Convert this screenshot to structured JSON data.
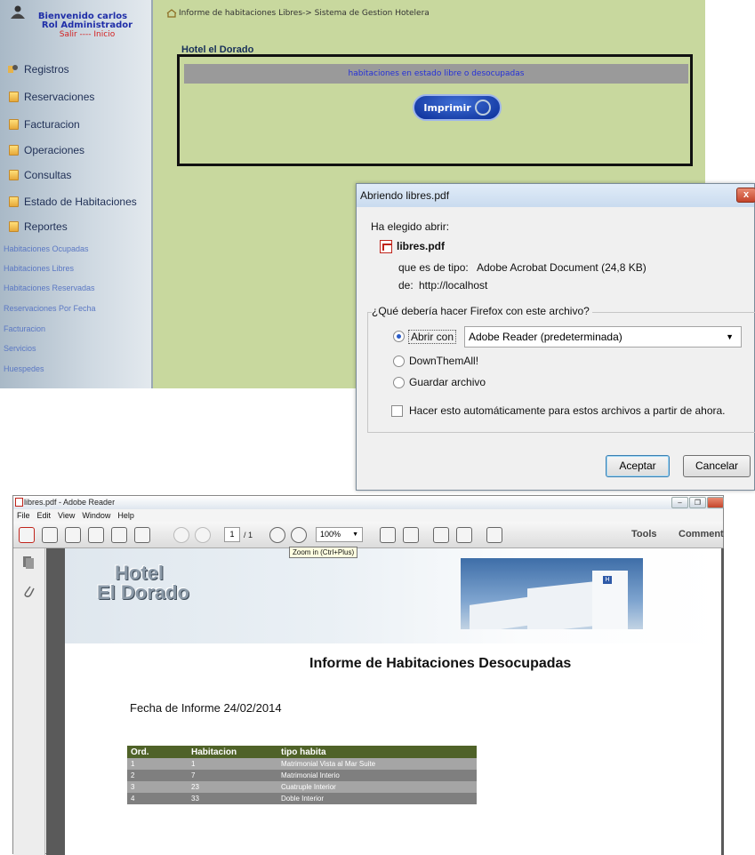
{
  "webapp": {
    "user": {
      "greeting": "Bienvenido carlos",
      "role": "Rol Administrador",
      "links": "Salir ---- Inicio"
    },
    "nav": [
      "Registros",
      "Reservaciones",
      "Facturacion",
      "Operaciones",
      "Consultas",
      "Estado de Habitaciones",
      "Reportes"
    ],
    "subnav": [
      "Habitaciones Ocupadas",
      "Habitaciones Libres",
      "Habitaciones Reservadas",
      "Reservaciones Por Fecha",
      "Facturacion",
      "Servicios",
      "Huespedes"
    ],
    "breadcrumb": "Informe de habitaciones Libres-> Sistema de Gestion Hotelera",
    "hotel_name": "Hotel el Dorado",
    "panel_heading": "habitaciones en estado libre o desocupadas",
    "print_button": "Imprimir"
  },
  "dialog": {
    "title": "Abriendo libres.pdf",
    "close": "x",
    "chosen": "Ha elegido abrir:",
    "file_name": "libres.pdf",
    "type_label": "que es de tipo:",
    "type_value": "Adobe Acrobat Document (24,8 KB)",
    "from_label": "de:",
    "from_value": "http://localhost",
    "question": "¿Qué debería hacer Firefox con este archivo?",
    "open_with": "Abrir con",
    "app": "Adobe Reader  (predeterminada)",
    "downthemall": "DownThemAll!",
    "save": "Guardar archivo",
    "auto": "Hacer esto automáticamente para estos archivos a partir de ahora.",
    "ok": "Aceptar",
    "cancel": "Cancelar",
    "open_with_selected": true
  },
  "reader": {
    "title": "libres.pdf - Adobe Reader",
    "menu": [
      "File",
      "Edit",
      "View",
      "Window",
      "Help"
    ],
    "page_current": "1",
    "page_total": "/ 1",
    "zoom": "100%",
    "tooltip": "Zoom in (Ctrl+Plus)",
    "tools": "Tools",
    "comment": "Comment"
  },
  "pdf": {
    "logo_line1": "Hotel",
    "logo_line2": "El Dorado",
    "heading": "Informe de Habitaciones Desocupadas",
    "date_line": "Fecha de Informe 24/02/2014",
    "columns": [
      "Ord.",
      "Habitacion",
      "tipo habita"
    ],
    "rows": [
      [
        "1",
        "1",
        "Matrimonial Vista al Mar Suite"
      ],
      [
        "2",
        "7",
        "Matrimonial Interio"
      ],
      [
        "3",
        "23",
        "Cuatruple Interior"
      ],
      [
        "4",
        "33",
        "Doble Interior"
      ]
    ]
  },
  "colors": {
    "webapp_bg": "#c8d89e",
    "table_header": "#4f6228",
    "link_blue": "#5b78c3",
    "user_red": "#d42020"
  }
}
